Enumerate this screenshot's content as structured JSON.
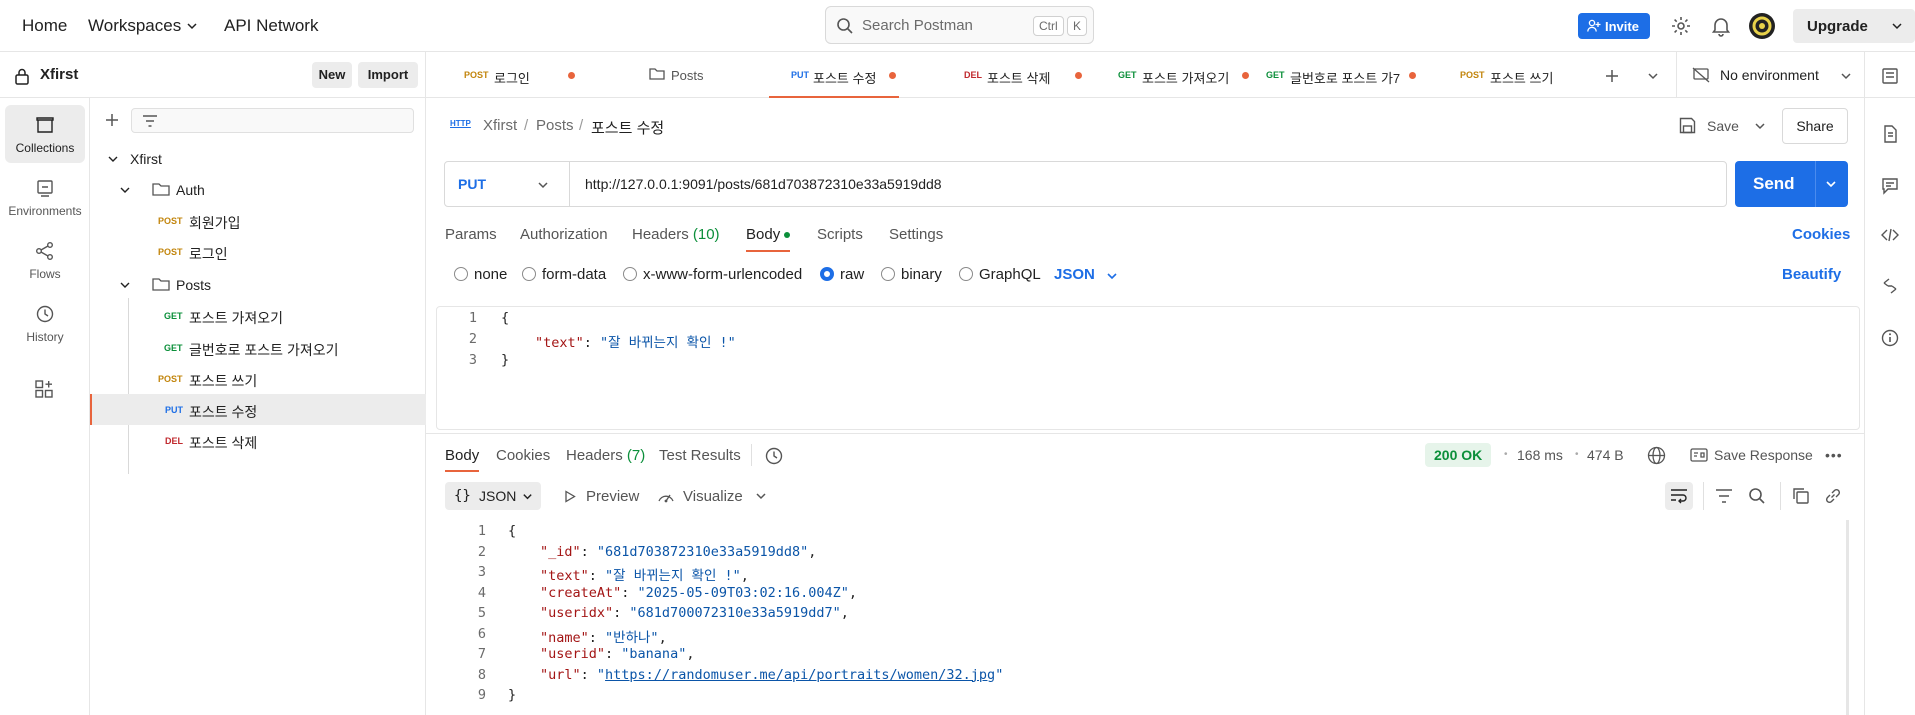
{
  "topbar": {
    "nav": [
      "Home",
      "Workspaces",
      "API Network"
    ],
    "search_placeholder": "Search Postman",
    "shortcut_ctrl": "Ctrl",
    "shortcut_key": "K",
    "invite": "Invite",
    "upgrade": "Upgrade"
  },
  "workspace": {
    "name": "Xfirst",
    "new_label": "New",
    "import_label": "Import"
  },
  "rail": [
    "Collections",
    "Environments",
    "Flows",
    "History"
  ],
  "tree": {
    "collection": "Xfirst",
    "folder_auth": "Auth",
    "auth_items": [
      {
        "method": "POST",
        "name": "회원가입"
      },
      {
        "method": "POST",
        "name": "로그인"
      }
    ],
    "folder_posts": "Posts",
    "posts_items": [
      {
        "method": "GET",
        "name": "포스트 가져오기"
      },
      {
        "method": "GET",
        "name": "글번호로 포스트 가져오기"
      },
      {
        "method": "POST",
        "name": "포스트 쓰기"
      },
      {
        "method": "PUT",
        "name": "포스트 수정"
      },
      {
        "method": "DEL",
        "name": "포스트 삭제"
      }
    ]
  },
  "tabs": [
    {
      "method": "POST",
      "label": "로그인"
    },
    {
      "method": "",
      "label": "Posts"
    },
    {
      "method": "PUT",
      "label": "포스트 수정"
    },
    {
      "method": "DEL",
      "label": "포스트 삭제"
    },
    {
      "method": "GET",
      "label": "포스트 가져오기"
    },
    {
      "method": "GET",
      "label": "글번호로 포스트 가7"
    },
    {
      "method": "POST",
      "label": "포스트 쓰기"
    }
  ],
  "environment": "No environment",
  "breadcrumb": {
    "icon_text": "HTTP",
    "root": "Xfirst",
    "folder": "Posts",
    "current": "포스트 수정"
  },
  "actions": {
    "save": "Save",
    "share": "Share"
  },
  "request": {
    "method": "PUT",
    "url": "http://127.0.0.1:9091/posts/681d703872310e33a5919dd8",
    "send": "Send",
    "tabs": {
      "params": "Params",
      "authorization": "Authorization",
      "headers": "Headers",
      "headers_count": "(10)",
      "body": "Body",
      "scripts": "Scripts",
      "settings": "Settings"
    },
    "cookies": "Cookies",
    "body_types": [
      "none",
      "form-data",
      "x-www-form-urlencoded",
      "raw",
      "binary",
      "GraphQL"
    ],
    "format": "JSON",
    "beautify": "Beautify",
    "body_lines": [
      {
        "n": "1",
        "open": "{"
      },
      {
        "n": "2",
        "key": "\"text\"",
        "value": "\"잘 바뀌는지 확인 !\""
      },
      {
        "n": "3",
        "close": "}"
      }
    ]
  },
  "response": {
    "tabs": {
      "body": "Body",
      "cookies": "Cookies",
      "headers": "Headers",
      "headers_count": "(7)",
      "test_results": "Test Results"
    },
    "status": "200 OK",
    "time": "168 ms",
    "size": "474 B",
    "save_response": "Save Response",
    "view": {
      "format": "JSON",
      "preview": "Preview",
      "visualize": "Visualize"
    },
    "lines": [
      {
        "n": "1",
        "text": "{"
      },
      {
        "n": "2",
        "key": "\"_id\"",
        "value": "\"681d703872310e33a5919dd8\"",
        "tail": ","
      },
      {
        "n": "3",
        "key": "\"text\"",
        "value": "\"잘 바뀌는지 확인 !\"",
        "tail": ","
      },
      {
        "n": "4",
        "key": "\"createAt\"",
        "value": "\"2025-05-09T03:02:16.004Z\"",
        "tail": ","
      },
      {
        "n": "5",
        "key": "\"useridx\"",
        "value": "\"681d700072310e33a5919dd7\"",
        "tail": ","
      },
      {
        "n": "6",
        "key": "\"name\"",
        "value": "\"반하나\"",
        "tail": ","
      },
      {
        "n": "7",
        "key": "\"userid\"",
        "value": "\"banana\"",
        "tail": ","
      },
      {
        "n": "8",
        "key": "\"url\"",
        "value_pre": "\"",
        "link": "https://randomuser.me/api/portraits/women/32.jpg",
        "value_post": "\"",
        "tail": ""
      },
      {
        "n": "9",
        "text": "}"
      }
    ]
  },
  "colors": {
    "accent": "#1d6ee6",
    "post": "#c2850c",
    "get": "#0b8f3a",
    "put": "#1d6ee6",
    "del": "#c0292e",
    "status_ok": "#0b8f3a"
  }
}
